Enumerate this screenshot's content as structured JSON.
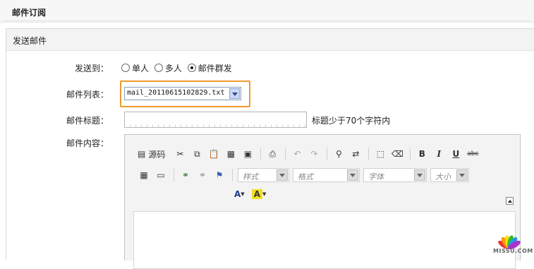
{
  "header": {
    "title": "邮件订阅"
  },
  "panel": {
    "title": "发送邮件"
  },
  "form": {
    "send_to_label": "发送到：",
    "send_to_options": [
      {
        "label": "单人",
        "selected": false
      },
      {
        "label": "多人",
        "selected": false
      },
      {
        "label": "邮件群发",
        "selected": true
      }
    ],
    "mail_list_label": "邮件列表：",
    "mail_list_value": "mail_20110615102829.txt",
    "subject_label": "邮件标题：",
    "subject_value": "",
    "subject_hint": "标题少于70个字符内",
    "content_label": "邮件内容："
  },
  "editor": {
    "source_label": "源码",
    "combos": [
      "样式",
      "格式",
      "字体",
      "大小"
    ],
    "toolbar_icons": [
      "source-icon",
      "cut-icon",
      "copy-icon",
      "paste-icon",
      "paste-text-icon",
      "paste-word-icon",
      "print-icon",
      "undo-icon",
      "redo-icon",
      "find-icon",
      "replace-icon",
      "select-all-icon",
      "remove-format-icon",
      "bold-icon",
      "italic-icon",
      "underline-icon",
      "strike-icon",
      "table-icon",
      "horizontal-rule-icon",
      "link-icon",
      "unlink-icon",
      "anchor-icon",
      "text-color-icon",
      "bg-color-icon"
    ]
  },
  "watermark": {
    "text": "MISSU.COM"
  },
  "colors": {
    "focus_border": "#f09a30",
    "select_button": "#c9d8f5"
  }
}
